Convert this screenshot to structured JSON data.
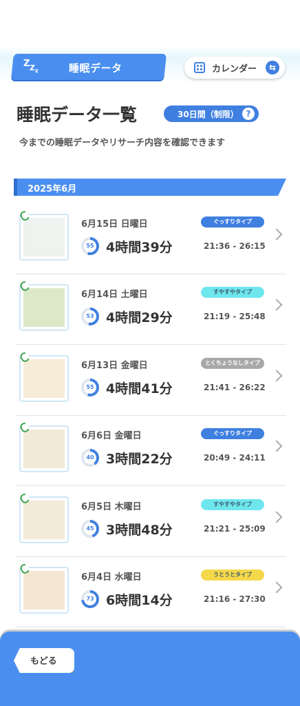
{
  "header": {
    "tab_title": "睡眠データ",
    "calendar_label": "カレンダー"
  },
  "heading": {
    "title": "睡眠データ一覧",
    "days_badge": "30日間（制限）",
    "help": "?",
    "subtitle": "今までの睡眠データやリサーチ内容を確認できます"
  },
  "month": "2025年6月",
  "colors": {
    "accent": "#4a8ff0",
    "ring": "#3f7fe0",
    "type_deep": "#3f7fe0",
    "type_sound": "#6ee6ee",
    "type_none": "#a8a8a8",
    "type_doze": "#f5d84a"
  },
  "entries": [
    {
      "date": "6月15日 日曜日",
      "score": "55",
      "score_pct": 55,
      "duration": "4時間39分",
      "type": "ぐっすりタイプ",
      "type_color": "#3f7fe0",
      "time": "21:36 - 26:15"
    },
    {
      "date": "6月14日 土曜日",
      "score": "53",
      "score_pct": 53,
      "duration": "4時間29分",
      "type": "すやすやタイプ",
      "type_color": "#6ee6ee",
      "time": "21:19 - 25:48"
    },
    {
      "date": "6月13日 金曜日",
      "score": "55",
      "score_pct": 55,
      "duration": "4時間41分",
      "type": "とくちょうなしタイプ",
      "type_color": "#a8a8a8",
      "time": "21:41 - 26:22"
    },
    {
      "date": "6月6日 金曜日",
      "score": "40",
      "score_pct": 40,
      "duration": "3時間22分",
      "type": "ぐっすりタイプ",
      "type_color": "#3f7fe0",
      "time": "20:49 - 24:11"
    },
    {
      "date": "6月5日 木曜日",
      "score": "45",
      "score_pct": 45,
      "duration": "3時間48分",
      "type": "すやすやタイプ",
      "type_color": "#6ee6ee",
      "time": "21:21 - 25:09"
    },
    {
      "date": "6月4日 水曜日",
      "score": "73",
      "score_pct": 73,
      "duration": "6時間14分",
      "type": "うとうとタイプ",
      "type_color": "#f5d84a",
      "time": "21:16 - 27:30"
    }
  ],
  "footer": {
    "back_label": "もどる"
  }
}
